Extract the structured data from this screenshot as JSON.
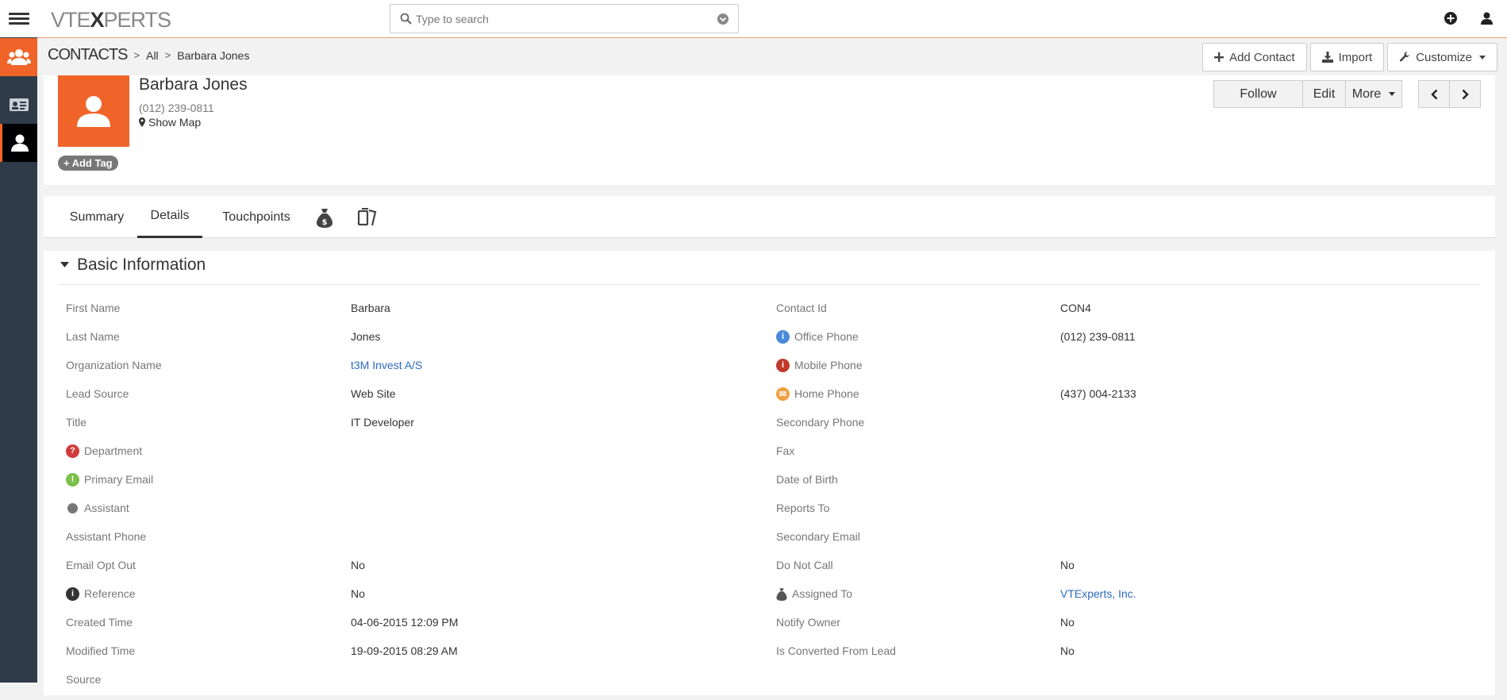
{
  "app": {
    "logo_text_a": "VTE",
    "logo_text_x": "X",
    "logo_text_b": "PERTS"
  },
  "search": {
    "placeholder": "Type to search"
  },
  "breadcrumb": {
    "module": "CONTACTS",
    "filter": "All",
    "record": "Barbara Jones"
  },
  "header_buttons": {
    "add_contact": "Add Contact",
    "import": "Import",
    "customize": "Customize"
  },
  "record": {
    "name": "Barbara Jones",
    "phone": "(012) 239-0811",
    "show_map": "Show Map",
    "add_tag": "Add Tag"
  },
  "actions": {
    "follow": "Follow",
    "edit": "Edit",
    "more": "More"
  },
  "tabs": [
    {
      "label": "Summary"
    },
    {
      "label": "Details"
    },
    {
      "label": "Touchpoints"
    }
  ],
  "section": {
    "title": "Basic Information"
  },
  "fields_left": [
    {
      "label": "First Name",
      "value": "Barbara"
    },
    {
      "label": "Last Name",
      "value": "Jones"
    },
    {
      "label": "Organization Name",
      "value": "t3M Invest A/S"
    },
    {
      "label": "Lead Source",
      "value": "Web Site"
    },
    {
      "label": "Title",
      "value": "IT Developer"
    },
    {
      "label": "Department",
      "value": ""
    },
    {
      "label": "Primary Email",
      "value": ""
    },
    {
      "label": "Assistant",
      "value": ""
    },
    {
      "label": "Assistant Phone",
      "value": ""
    },
    {
      "label": "Email Opt Out",
      "value": "No"
    },
    {
      "label": "Reference",
      "value": "No"
    },
    {
      "label": "Created Time",
      "value": "04-06-2015 12:09 PM"
    },
    {
      "label": "Modified Time",
      "value": "19-09-2015 08:29 AM"
    },
    {
      "label": "Source",
      "value": ""
    }
  ],
  "fields_right": [
    {
      "label": "Contact Id",
      "value": "CON4"
    },
    {
      "label": "Office Phone",
      "value": "(012) 239-0811"
    },
    {
      "label": "Mobile Phone",
      "value": ""
    },
    {
      "label": "Home Phone",
      "value": "(437) 004-2133"
    },
    {
      "label": "Secondary Phone",
      "value": ""
    },
    {
      "label": "Fax",
      "value": ""
    },
    {
      "label": "Date of Birth",
      "value": ""
    },
    {
      "label": "Reports To",
      "value": ""
    },
    {
      "label": "Secondary Email",
      "value": ""
    },
    {
      "label": "Do Not Call",
      "value": "No"
    },
    {
      "label": "Assigned To",
      "value": "VTExperts, Inc."
    },
    {
      "label": "Notify Owner",
      "value": "No"
    },
    {
      "label": "Is Converted From Lead",
      "value": "No"
    }
  ],
  "colors": {
    "accent": "#f0642a",
    "sidebar": "#2f3b48",
    "link": "#2d6ac0"
  }
}
